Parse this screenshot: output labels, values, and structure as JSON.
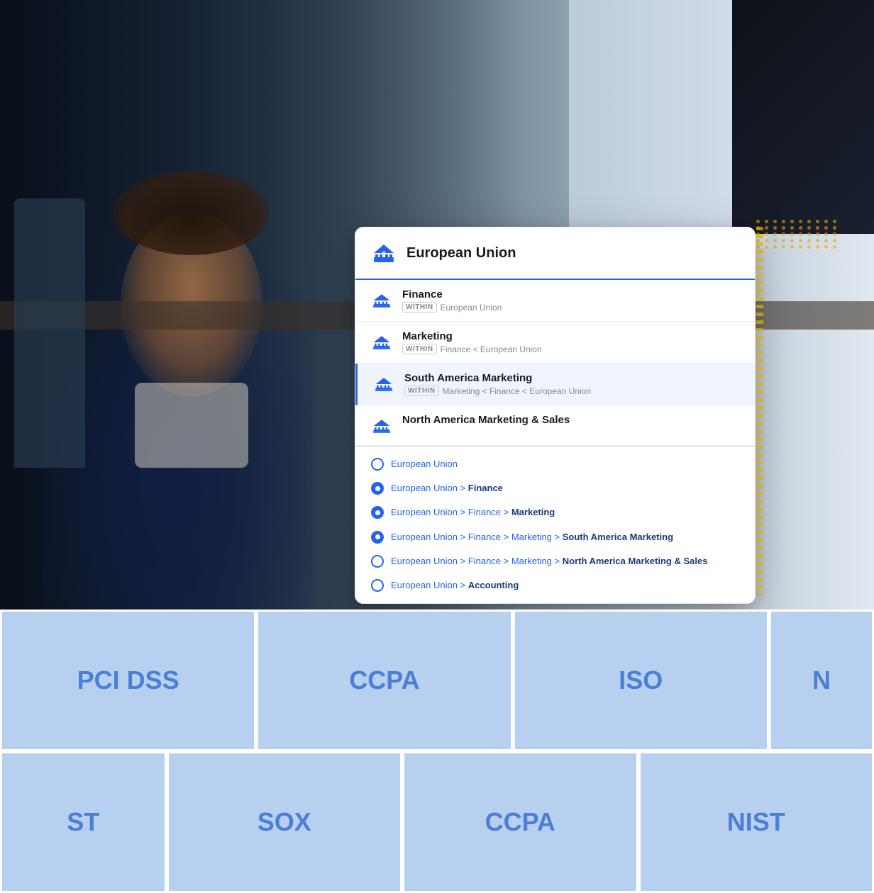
{
  "background": {
    "alt": "Woman in office smiling at camera"
  },
  "panel": {
    "main_result": {
      "title": "European Union",
      "icon": "institution-icon"
    },
    "sub_results": [
      {
        "id": "finance",
        "name": "Finance",
        "within_label": "WITHIN",
        "within_path": "European Union"
      },
      {
        "id": "marketing",
        "name": "Marketing",
        "within_label": "WITHIN",
        "within_path": "Finance < European Union"
      },
      {
        "id": "south-america-marketing",
        "name": "South America Marketing",
        "within_label": "WITHIN",
        "within_path": "Marketing < Finance < European Union"
      },
      {
        "id": "north-america-marketing-sales",
        "name": "North America Marketing & Sales",
        "within_label": "",
        "within_path": ""
      }
    ],
    "radio_options": [
      {
        "id": "eu-only",
        "selected": false,
        "text_parts": [
          {
            "text": "European Union",
            "bold": false
          }
        ]
      },
      {
        "id": "eu-finance",
        "selected": true,
        "text_parts": [
          {
            "text": "European Union",
            "bold": false
          },
          {
            "text": " > ",
            "bold": false
          },
          {
            "text": "Finance",
            "bold": true
          }
        ]
      },
      {
        "id": "eu-finance-marketing",
        "selected": true,
        "text_parts": [
          {
            "text": "European Union",
            "bold": false
          },
          {
            "text": " > Finance > ",
            "bold": false
          },
          {
            "text": "Marketing",
            "bold": true
          }
        ]
      },
      {
        "id": "eu-finance-marketing-south",
        "selected": true,
        "text_parts": [
          {
            "text": "European Union",
            "bold": false
          },
          {
            "text": " > Finance > Marketing > ",
            "bold": false
          },
          {
            "text": "South America Marketing",
            "bold": true
          }
        ]
      },
      {
        "id": "eu-finance-marketing-north",
        "selected": false,
        "text_parts": [
          {
            "text": "European Union",
            "bold": false
          },
          {
            "text": " > Finance > Marketing > ",
            "bold": false
          },
          {
            "text": "North America Marketing & Sales",
            "bold": true
          }
        ]
      },
      {
        "id": "eu-accounting",
        "selected": false,
        "text_parts": [
          {
            "text": "European Union",
            "bold": false
          },
          {
            "text": " > ",
            "bold": false
          },
          {
            "text": "Accounting",
            "bold": true
          }
        ]
      }
    ]
  },
  "compliance_tiles": {
    "row1": [
      "PCI DSS",
      "CCPA",
      "ISO",
      "N"
    ],
    "row2": [
      "ST",
      "SOX",
      "CCPA",
      "NIST"
    ]
  }
}
